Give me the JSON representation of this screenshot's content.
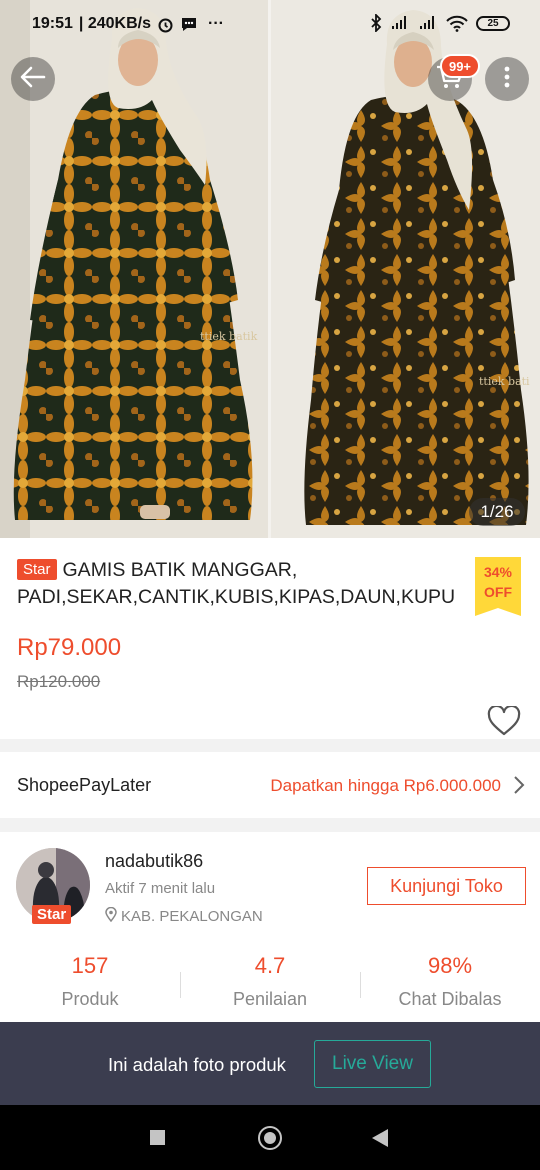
{
  "status_bar": {
    "time": "19:51",
    "network_speed": "| 240KB/s",
    "more_dots": "···",
    "battery": "25"
  },
  "gallery": {
    "counter": "1/26",
    "cart_badge": "99+",
    "photo_watermark_left": "ttiek batik",
    "photo_watermark_right": "ttiek bati"
  },
  "product": {
    "star_label": "Star",
    "title": "GAMIS BATIK MANGGAR, PADI,SEKAR,CANTIK,KUBIS,KIPAS,DAUN,KUPU",
    "discount_percent": "34%",
    "discount_word": "OFF",
    "price": "Rp79.000",
    "original_price": "Rp120.000"
  },
  "paylater": {
    "label": "ShopeePayLater",
    "promo": "Dapatkan hingga Rp6.000.000"
  },
  "shop": {
    "star_label": "Star",
    "name": "nadabutik86",
    "active": "Aktif 7 menit lalu",
    "location": "KAB. PEKALONGAN",
    "visit_button": "Kunjungi Toko",
    "stats": [
      {
        "value": "157",
        "label": "Produk"
      },
      {
        "value": "4.7",
        "label": "Penilaian"
      },
      {
        "value": "98%",
        "label": "Chat Dibalas"
      }
    ]
  },
  "banner": {
    "text": "Ini adalah foto produk",
    "button": "Live View"
  },
  "colors": {
    "accent": "#ee4d2d",
    "discount_bg": "#ffd839",
    "live_view": "#26aa99",
    "banner_bg": "#3b3d4f"
  }
}
